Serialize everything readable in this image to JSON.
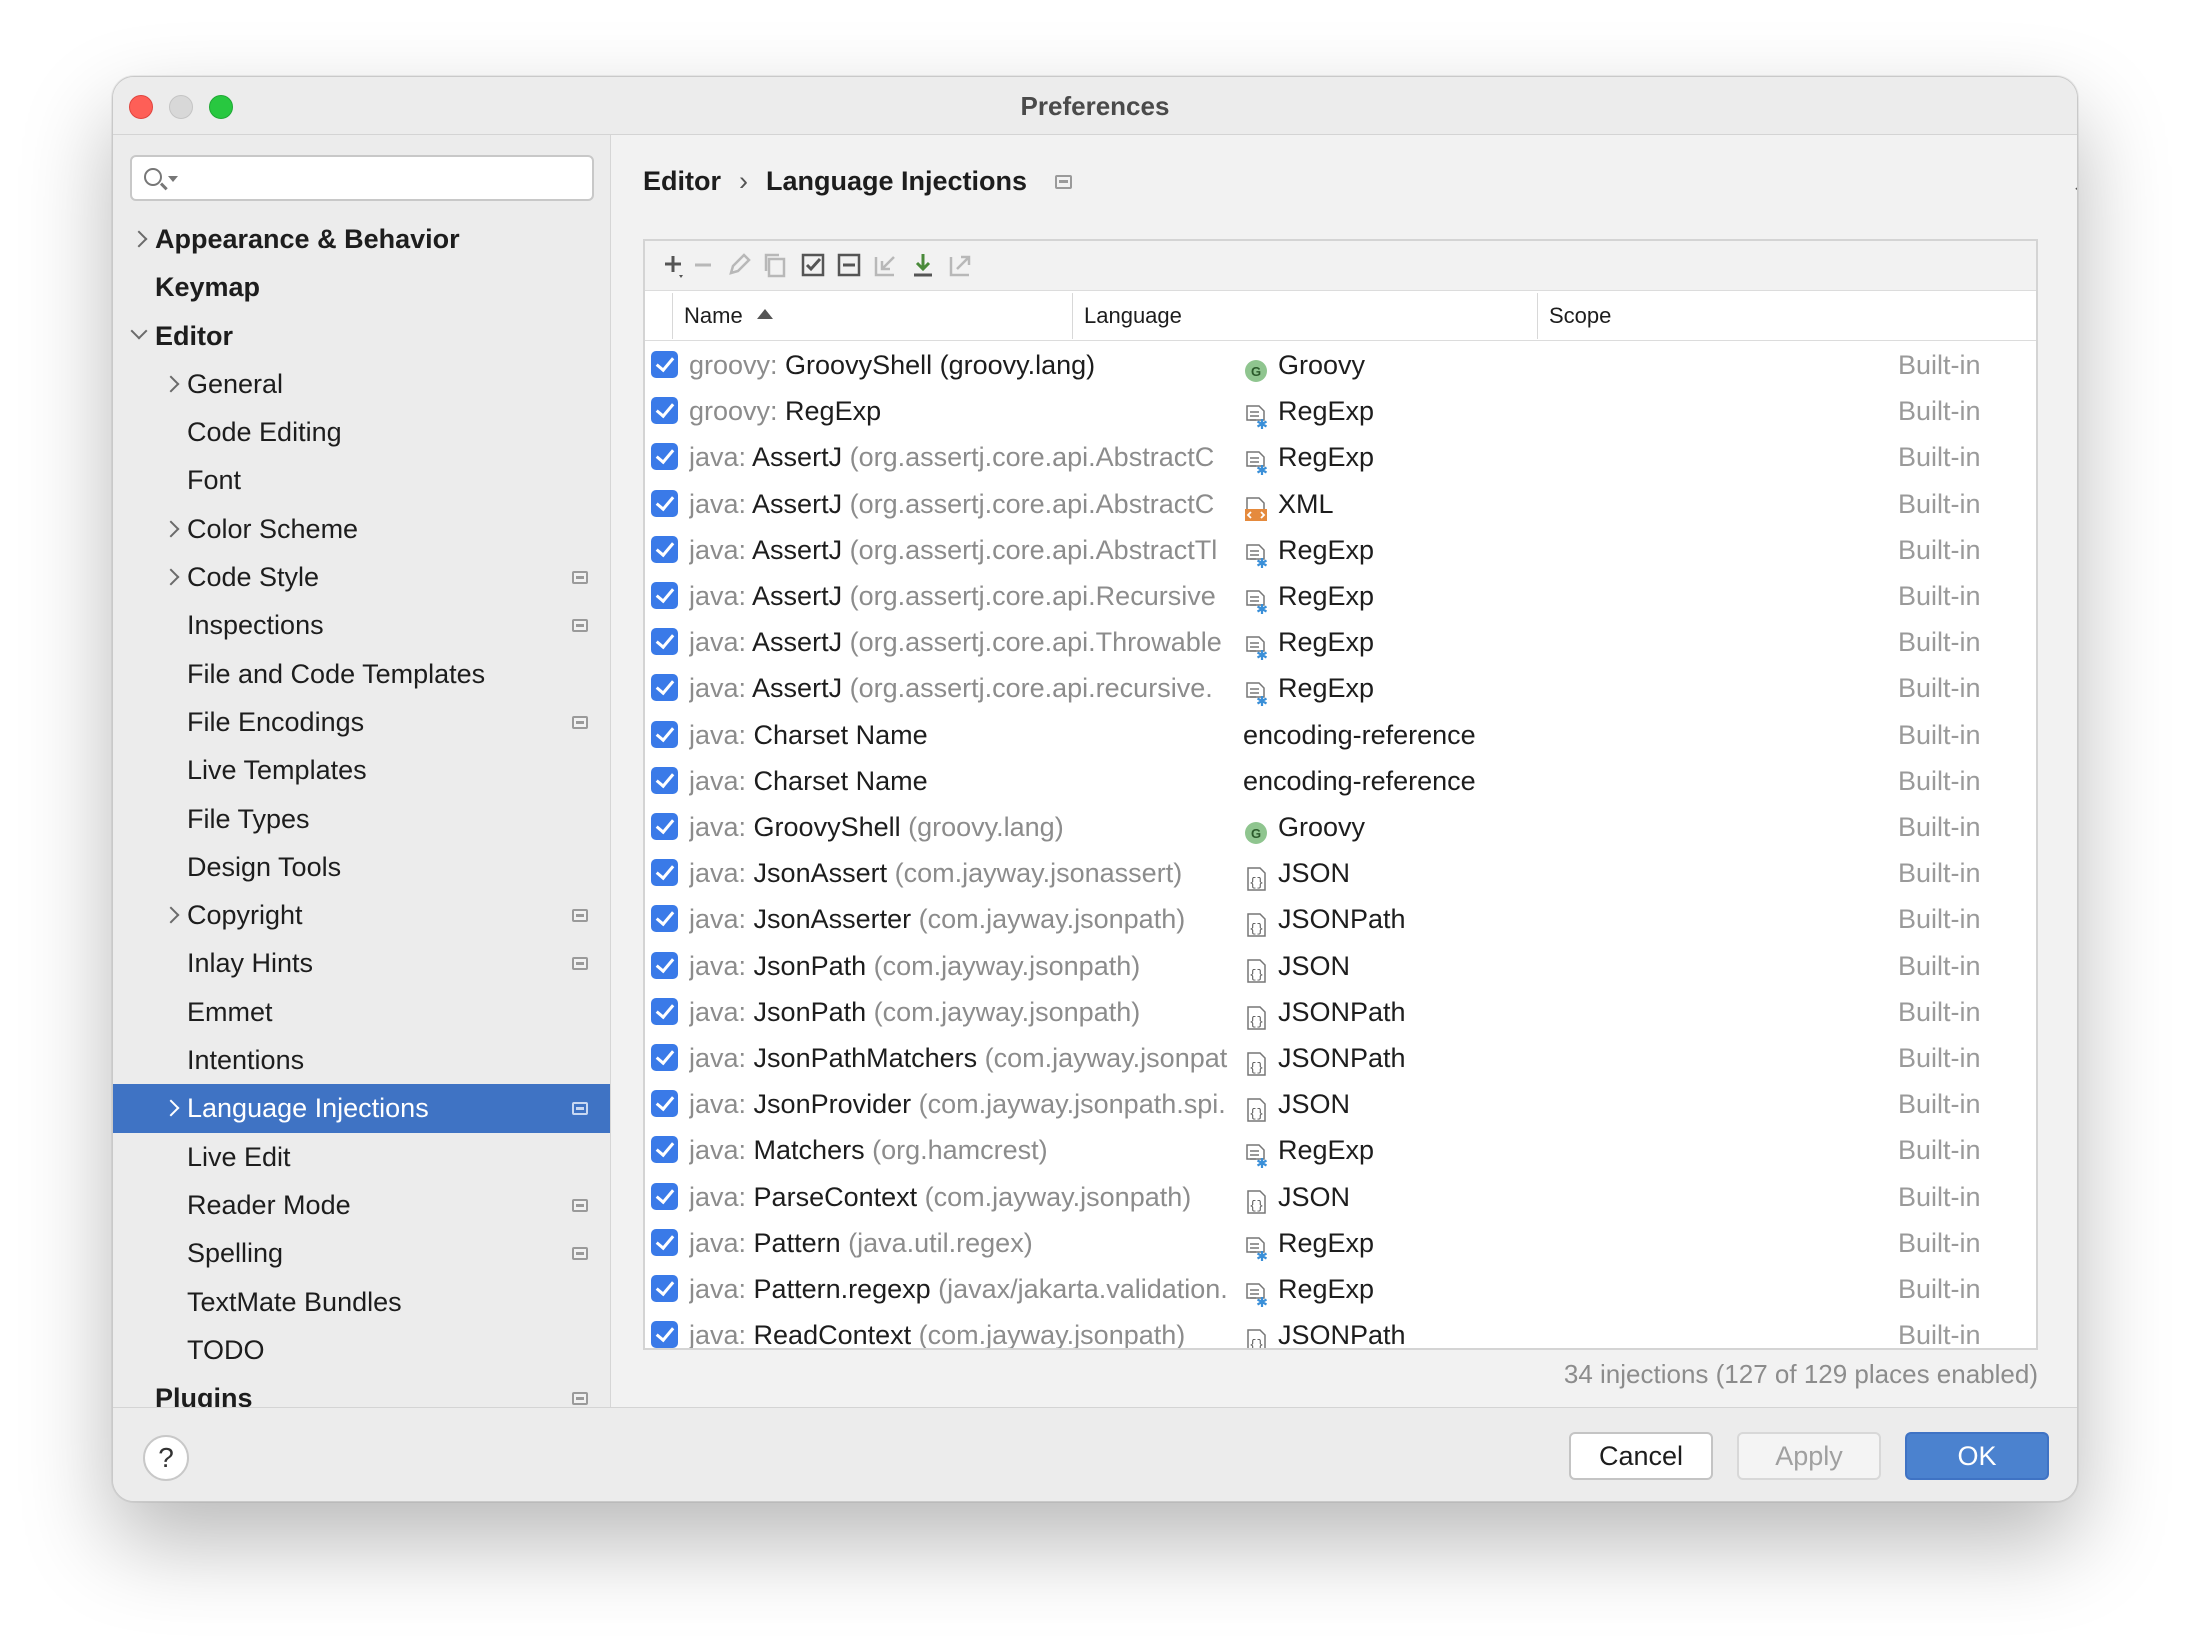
{
  "window": {
    "title": "Preferences"
  },
  "search": {
    "placeholder": ""
  },
  "sidebar": {
    "items": [
      {
        "label": "Appearance & Behavior",
        "level": 0,
        "chevron": "right",
        "bold": true,
        "project": false,
        "selected": false
      },
      {
        "label": "Keymap",
        "level": 0,
        "chevron": "none",
        "bold": true,
        "project": false,
        "selected": false
      },
      {
        "label": "Editor",
        "level": 0,
        "chevron": "down",
        "bold": true,
        "project": false,
        "selected": false
      },
      {
        "label": "General",
        "level": 1,
        "chevron": "right",
        "bold": false,
        "project": false,
        "selected": false
      },
      {
        "label": "Code Editing",
        "level": 1,
        "chevron": "none",
        "bold": false,
        "project": false,
        "selected": false
      },
      {
        "label": "Font",
        "level": 1,
        "chevron": "none",
        "bold": false,
        "project": false,
        "selected": false
      },
      {
        "label": "Color Scheme",
        "level": 1,
        "chevron": "right",
        "bold": false,
        "project": false,
        "selected": false
      },
      {
        "label": "Code Style",
        "level": 1,
        "chevron": "right",
        "bold": false,
        "project": true,
        "selected": false
      },
      {
        "label": "Inspections",
        "level": 1,
        "chevron": "none",
        "bold": false,
        "project": true,
        "selected": false
      },
      {
        "label": "File and Code Templates",
        "level": 1,
        "chevron": "none",
        "bold": false,
        "project": false,
        "selected": false
      },
      {
        "label": "File Encodings",
        "level": 1,
        "chevron": "none",
        "bold": false,
        "project": true,
        "selected": false
      },
      {
        "label": "Live Templates",
        "level": 1,
        "chevron": "none",
        "bold": false,
        "project": false,
        "selected": false
      },
      {
        "label": "File Types",
        "level": 1,
        "chevron": "none",
        "bold": false,
        "project": false,
        "selected": false
      },
      {
        "label": "Design Tools",
        "level": 1,
        "chevron": "none",
        "bold": false,
        "project": false,
        "selected": false
      },
      {
        "label": "Copyright",
        "level": 1,
        "chevron": "right",
        "bold": false,
        "project": true,
        "selected": false
      },
      {
        "label": "Inlay Hints",
        "level": 1,
        "chevron": "none",
        "bold": false,
        "project": true,
        "selected": false
      },
      {
        "label": "Emmet",
        "level": 1,
        "chevron": "none",
        "bold": false,
        "project": false,
        "selected": false
      },
      {
        "label": "Intentions",
        "level": 1,
        "chevron": "none",
        "bold": false,
        "project": false,
        "selected": false
      },
      {
        "label": "Language Injections",
        "level": 1,
        "chevron": "right",
        "bold": false,
        "project": true,
        "selected": true
      },
      {
        "label": "Live Edit",
        "level": 1,
        "chevron": "none",
        "bold": false,
        "project": false,
        "selected": false
      },
      {
        "label": "Reader Mode",
        "level": 1,
        "chevron": "none",
        "bold": false,
        "project": true,
        "selected": false
      },
      {
        "label": "Spelling",
        "level": 1,
        "chevron": "none",
        "bold": false,
        "project": true,
        "selected": false
      },
      {
        "label": "TextMate Bundles",
        "level": 1,
        "chevron": "none",
        "bold": false,
        "project": false,
        "selected": false
      },
      {
        "label": "TODO",
        "level": 1,
        "chevron": "none",
        "bold": false,
        "project": false,
        "selected": false
      },
      {
        "label": "Plugins",
        "level": 0,
        "chevron": "none",
        "bold": true,
        "project": true,
        "selected": false
      }
    ]
  },
  "breadcrumb": {
    "parent": "Editor",
    "separator": "›",
    "current": "Language Injections"
  },
  "nav": {
    "back": "←",
    "forward": "→"
  },
  "toolbar": {
    "icons": [
      "add-icon",
      "remove-icon",
      "edit-icon",
      "duplicate-icon",
      "enable-all-icon",
      "disable-all-icon",
      "import-icon",
      "download-icon",
      "export-icon"
    ]
  },
  "table": {
    "columns": {
      "name": "Name",
      "language": "Language",
      "scope": "Scope"
    },
    "rows": [
      {
        "prefix": "groovy: ",
        "name": "GroovyShell (groovy.lang)",
        "qualifier": "",
        "language": "Groovy",
        "icon": "groovy",
        "scope": "Built-in"
      },
      {
        "prefix": "groovy: ",
        "name": "RegExp",
        "qualifier": "",
        "language": "RegExp",
        "icon": "regexp",
        "scope": "Built-in"
      },
      {
        "prefix": "java: ",
        "name": "AssertJ",
        "qualifier": " (org.assertj.core.api.AbstractC",
        "language": "RegExp",
        "icon": "regexp",
        "scope": "Built-in"
      },
      {
        "prefix": "java: ",
        "name": "AssertJ",
        "qualifier": " (org.assertj.core.api.AbstractC",
        "language": "XML",
        "icon": "xml",
        "scope": "Built-in"
      },
      {
        "prefix": "java: ",
        "name": "AssertJ",
        "qualifier": " (org.assertj.core.api.AbstractTl",
        "language": "RegExp",
        "icon": "regexp",
        "scope": "Built-in"
      },
      {
        "prefix": "java: ",
        "name": "AssertJ",
        "qualifier": " (org.assertj.core.api.Recursive",
        "language": "RegExp",
        "icon": "regexp",
        "scope": "Built-in"
      },
      {
        "prefix": "java: ",
        "name": "AssertJ",
        "qualifier": " (org.assertj.core.api.Throwable",
        "language": "RegExp",
        "icon": "regexp",
        "scope": "Built-in"
      },
      {
        "prefix": "java: ",
        "name": "AssertJ",
        "qualifier": " (org.assertj.core.api.recursive.",
        "language": "RegExp",
        "icon": "regexp",
        "scope": "Built-in"
      },
      {
        "prefix": "java: ",
        "name": "Charset Name",
        "qualifier": "",
        "language": "encoding-reference",
        "icon": "none",
        "scope": "Built-in"
      },
      {
        "prefix": "java: ",
        "name": "Charset Name",
        "qualifier": "",
        "language": "encoding-reference",
        "icon": "none",
        "scope": "Built-in"
      },
      {
        "prefix": "java: ",
        "name": "GroovyShell",
        "qualifier": " (groovy.lang)",
        "language": "Groovy",
        "icon": "groovy",
        "scope": "Built-in"
      },
      {
        "prefix": "java: ",
        "name": "JsonAssert",
        "qualifier": " (com.jayway.jsonassert)",
        "language": "JSON",
        "icon": "json",
        "scope": "Built-in"
      },
      {
        "prefix": "java: ",
        "name": "JsonAsserter",
        "qualifier": " (com.jayway.jsonpath)",
        "language": "JSONPath",
        "icon": "json",
        "scope": "Built-in"
      },
      {
        "prefix": "java: ",
        "name": "JsonPath",
        "qualifier": " (com.jayway.jsonpath)",
        "language": "JSON",
        "icon": "json",
        "scope": "Built-in"
      },
      {
        "prefix": "java: ",
        "name": "JsonPath",
        "qualifier": " (com.jayway.jsonpath)",
        "language": "JSONPath",
        "icon": "json",
        "scope": "Built-in"
      },
      {
        "prefix": "java: ",
        "name": "JsonPathMatchers",
        "qualifier": " (com.jayway.jsonpat",
        "language": "JSONPath",
        "icon": "json",
        "scope": "Built-in"
      },
      {
        "prefix": "java: ",
        "name": "JsonProvider",
        "qualifier": " (com.jayway.jsonpath.spi.",
        "language": "JSON",
        "icon": "json",
        "scope": "Built-in"
      },
      {
        "prefix": "java: ",
        "name": "Matchers",
        "qualifier": " (org.hamcrest)",
        "language": "RegExp",
        "icon": "regexp",
        "scope": "Built-in"
      },
      {
        "prefix": "java: ",
        "name": "ParseContext",
        "qualifier": " (com.jayway.jsonpath)",
        "language": "JSON",
        "icon": "json",
        "scope": "Built-in"
      },
      {
        "prefix": "java: ",
        "name": "Pattern",
        "qualifier": " (java.util.regex)",
        "language": "RegExp",
        "icon": "regexp",
        "scope": "Built-in"
      },
      {
        "prefix": "java: ",
        "name": "Pattern.regexp",
        "qualifier": " (javax/jakarta.validation.",
        "language": "RegExp",
        "icon": "regexp",
        "scope": "Built-in"
      },
      {
        "prefix": "java: ",
        "name": "ReadContext",
        "qualifier": " (com.jayway.jsonpath)",
        "language": "JSONPath",
        "icon": "json",
        "scope": "Built-in"
      }
    ]
  },
  "status": "34 injections (127 of 129 places enabled)",
  "footer": {
    "help": "?",
    "cancel": "Cancel",
    "apply": "Apply",
    "ok": "OK"
  },
  "colors": {
    "selection": "#3f73c4",
    "checkbox": "#3a7ae8",
    "ok_button": "#4b82cf",
    "groovy": "#8fc58f",
    "xml": "#e58a3d"
  }
}
